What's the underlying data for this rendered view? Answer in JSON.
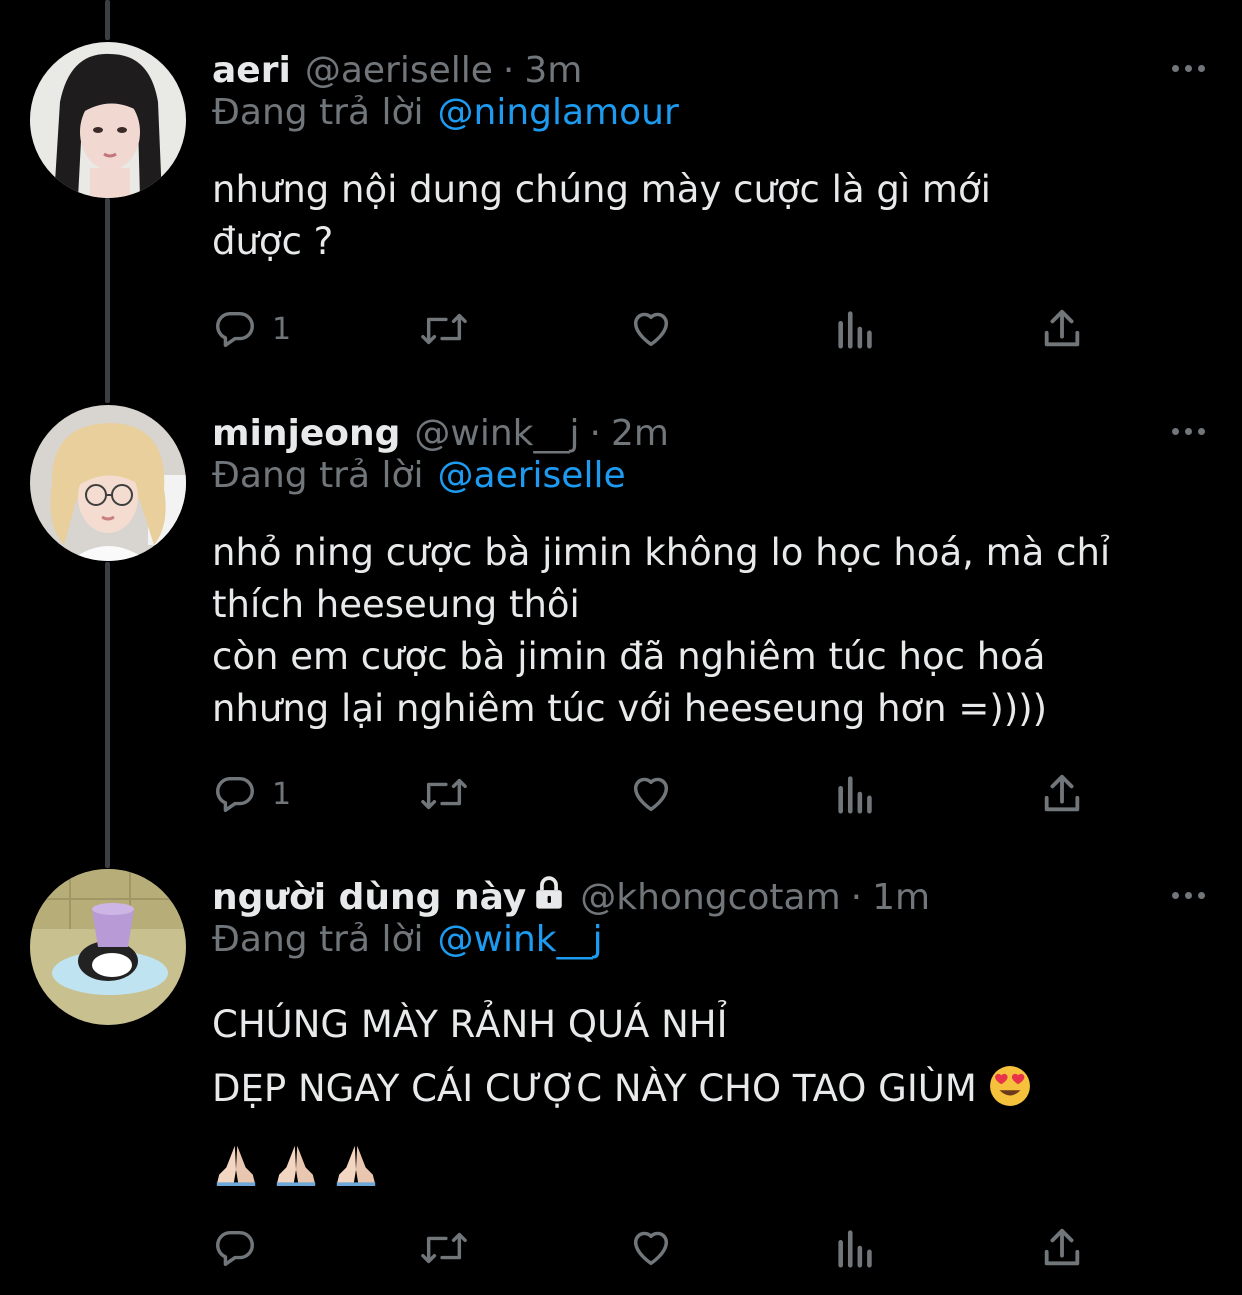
{
  "tweets": [
    {
      "name": "aeri",
      "handle": "@aeriselle",
      "separator": "·",
      "time": "3m",
      "reply_prefix": "Đang trả lời",
      "reply_to": "@ninglamour",
      "lines": [
        "nhưng nội dung chúng mày cược là gì mới",
        "được ?"
      ],
      "reply_count": "1"
    },
    {
      "name": "minjeong",
      "handle": "@wink__j",
      "separator": "·",
      "time": "2m",
      "reply_prefix": "Đang trả lời",
      "reply_to": "@aeriselle",
      "lines": [
        "nhỏ ning cược bà jimin không lo học hoá, mà chỉ",
        "thích heeseung thôi",
        "còn em cược bà jimin đã nghiêm túc học hoá",
        "nhưng lại nghiêm túc với heeseung hơn =))))"
      ],
      "reply_count": "1"
    },
    {
      "name": "người dùng này",
      "handle": "@khongcotam",
      "separator": "·",
      "time": "1m",
      "reply_prefix": "Đang trả lời",
      "reply_to": "@wink__j",
      "lines": [
        "CHÚNG MÀY RẢNH QUÁ NHỈ",
        "DẸP NGAY CÁI CƯỢC NÀY CHO TAO GIÙM",
        ""
      ],
      "reply_count": ""
    }
  ],
  "icons": {
    "reply": "reply-icon",
    "retweet": "retweet-icon",
    "like": "heart-icon",
    "views": "views-icon",
    "share": "share-icon",
    "more": "more-icon",
    "lock": "lock-icon",
    "emoji_heart_eyes": "heart-eyes-emoji",
    "emoji_pray": "folded-hands-emoji"
  },
  "colors": {
    "background": "#000000",
    "text": "#e7e9ea",
    "muted": "#71767b",
    "link": "#1d9bf0",
    "thread_line": "#3b3f44"
  }
}
